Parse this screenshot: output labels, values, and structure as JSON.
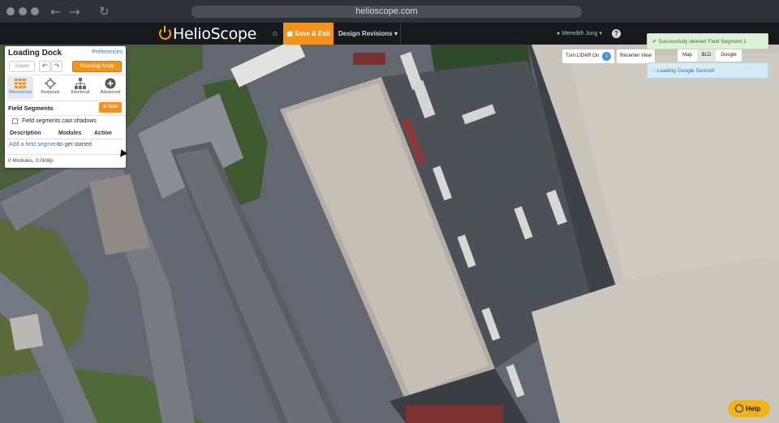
{
  "browser": {
    "url": "helioscope.com",
    "back_icon": "arrow-left-icon",
    "forward_icon": "arrow-right-icon",
    "reload_icon": "reload-icon"
  },
  "header": {
    "logo_text": "HelioScope",
    "home_icon": "home-icon",
    "save_exit_label": "Save & Exit",
    "design_revisions_label": "Design Revisions",
    "user_name": "Meredith Jung",
    "help_icon": "question-icon",
    "accent_color": "#f0941f"
  },
  "panel": {
    "title": "Loading Dock",
    "preferences_label": "Preferences",
    "saved_label": "Saved",
    "undo_icon": "undo-icon",
    "redo_icon": "redo-icon",
    "show_array_label": "Showing Array",
    "modes": [
      {
        "label": "Mechanical",
        "icon": "grid-icon",
        "active": true
      },
      {
        "label": "Keepouts",
        "icon": "move-icon",
        "active": false
      },
      {
        "label": "Electrical",
        "icon": "hierarchy-icon",
        "active": false
      },
      {
        "label": "Advanced",
        "icon": "plus-circle-icon",
        "active": false
      }
    ],
    "field_segments_title": "Field Segments",
    "new_label": "New",
    "shadows_checkbox_label": "Field segments cast shadows",
    "columns": [
      "Description",
      "Modules",
      "Action"
    ],
    "add_link_label": "Add a field segment",
    "add_link_suffix": "to get started",
    "summary": "0 Modules, 0.0kWp"
  },
  "map_controls": {
    "lidar_label": "Turn LIDAR On",
    "recenter_label": "Recenter View",
    "map_types": [
      "Map",
      "BLD",
      "Google"
    ],
    "selected_map_type": "BLD"
  },
  "notifications": {
    "success": "Successfully deleted Field Segment 1",
    "info": "Loading Google Sunroof"
  },
  "help_button_label": "Help"
}
